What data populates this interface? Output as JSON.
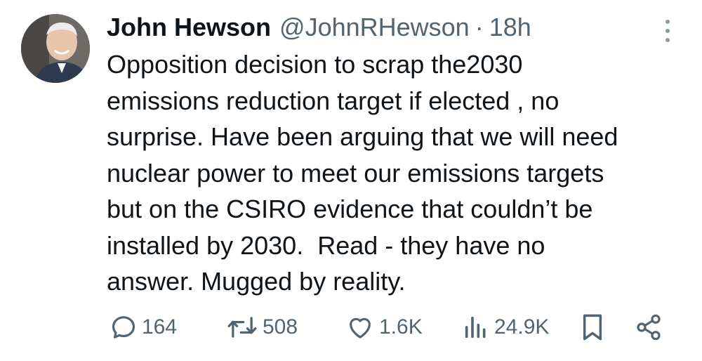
{
  "author": {
    "name": "John Hewson",
    "handle": "@JohnRHewson",
    "separator": "·",
    "time": "18h"
  },
  "tweet": {
    "text": "Opposition decision to scrap the2030\nemissions reduction target if elected , no\nsurprise. Have been arguing that we will need\nnuclear power to meet our emissions targets\nbut on the CSIRO evidence that couldn’t be\ninstalled by 2030.  Read - they have no\nanswer. Mugged by reality."
  },
  "actions": {
    "replies": "164",
    "reposts": "508",
    "likes": "1.6K",
    "views": "24.9K"
  },
  "icons": {
    "reply": "reply-icon",
    "repost": "repost-icon",
    "like": "like-icon",
    "views": "views-icon",
    "bookmark": "bookmark-icon",
    "share": "share-icon",
    "more": "more-icon"
  },
  "colors": {
    "text": "#0f1419",
    "secondary": "#536471"
  }
}
